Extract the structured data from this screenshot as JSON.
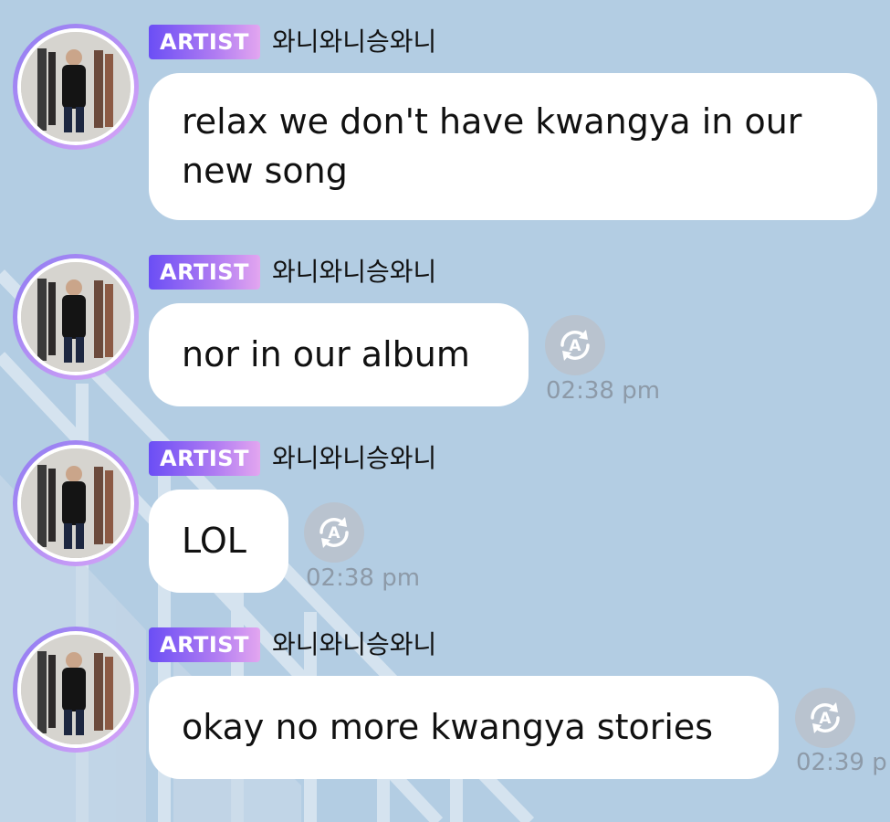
{
  "messages": [
    {
      "badge": "ARTIST",
      "sender": "와니와니승와니",
      "text_line1": "relax we don't have kwangya in our",
      "text_line2": "new song",
      "time": ""
    },
    {
      "badge": "ARTIST",
      "sender": "와니와니승와니",
      "text": "nor in our album",
      "time": "02:38 pm"
    },
    {
      "badge": "ARTIST",
      "sender": "와니와니승와니",
      "text": "LOL",
      "time": "02:38 pm"
    },
    {
      "badge": "ARTIST",
      "sender": "와니와니승와니",
      "text": "okay no more kwangya stories",
      "time": "02:39 p"
    }
  ],
  "icons": {
    "translate": "translate-icon",
    "avatar": "avatar"
  },
  "colors": {
    "background": "#b3cde3",
    "bubble": "#ffffff",
    "badge_start": "#6b4ef5",
    "badge_end": "#e3a6f0",
    "translate_button": "#b9c3cf",
    "time_text": "#8d9aa8"
  }
}
